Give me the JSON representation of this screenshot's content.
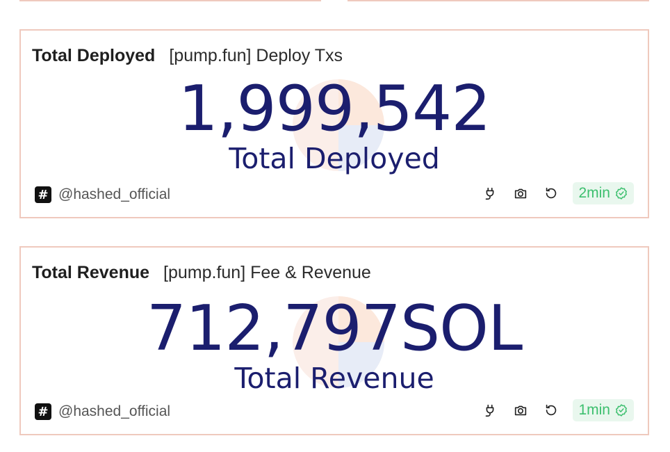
{
  "cards": [
    {
      "name": "Total Deployed",
      "query": "[pump.fun] Deploy Txs",
      "value": "1,999,542",
      "value_label": "Total Deployed",
      "author_badge": "#",
      "author": "@hashed_official",
      "refresh": "2min",
      "icons": [
        "plug-icon",
        "camera-icon",
        "refresh-icon",
        "check-badge-icon"
      ]
    },
    {
      "name": "Total Revenue",
      "query": "[pump.fun] Fee & Revenue",
      "value": "712,797SOL",
      "value_label": "Total Revenue",
      "author_badge": "#",
      "author": "@hashed_official",
      "refresh": "1min",
      "icons": [
        "plug-icon",
        "camera-icon",
        "refresh-icon",
        "check-badge-icon"
      ]
    }
  ],
  "colors": {
    "value": "#1b1e6e",
    "card_border": "#efc9bd",
    "refresh_bg": "#e9f7ee",
    "refresh_text": "#3cbf6e"
  }
}
